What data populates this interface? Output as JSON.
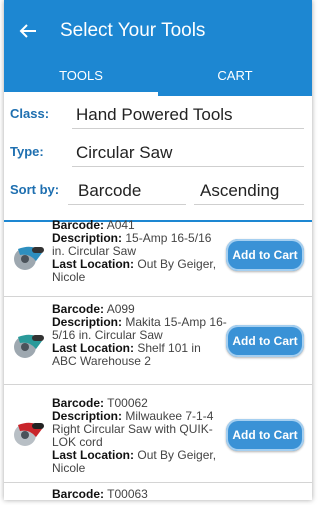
{
  "appbar": {
    "title": "Select Your Tools",
    "back_icon": "arrow-left-icon"
  },
  "tabs": [
    {
      "label": "TOOLS",
      "active": true
    },
    {
      "label": "CART",
      "active": false
    }
  ],
  "filters": {
    "class": {
      "label": "Class:",
      "value": "Hand Powered Tools"
    },
    "type": {
      "label": "Type:",
      "value": "Circular Saw"
    },
    "sort": {
      "label": "Sort by:",
      "field": "Barcode",
      "order": "Ascending"
    }
  },
  "field_labels": {
    "barcode": "Barcode:",
    "description": "Description:",
    "location": "Last Location:"
  },
  "items": [
    {
      "barcode": "A041",
      "description": "15-Amp 16-5/16 in. Circular Saw",
      "location": "Out By Geiger, Nicole",
      "button": "Add to Cart",
      "thumb": "circular-saw-icon"
    },
    {
      "barcode": "A099",
      "description": "Makita 15-Amp 16-5/16 in. Circular Saw",
      "location": "Shelf 101 in ABC Warehouse 2",
      "button": "Add to Cart",
      "thumb": "circular-saw-icon"
    },
    {
      "barcode": "T00062",
      "description": "Milwaukee 7-1-4 Right Circular Saw with QUIK-LOK cord",
      "location": "Out By Geiger, Nicole",
      "button": "Add to Cart",
      "thumb": "circular-saw-red-icon"
    },
    {
      "barcode": "T00063"
    }
  ],
  "colors": {
    "primary": "#1d87d2",
    "label": "#1e6fb0",
    "button": "#3a92d6"
  }
}
